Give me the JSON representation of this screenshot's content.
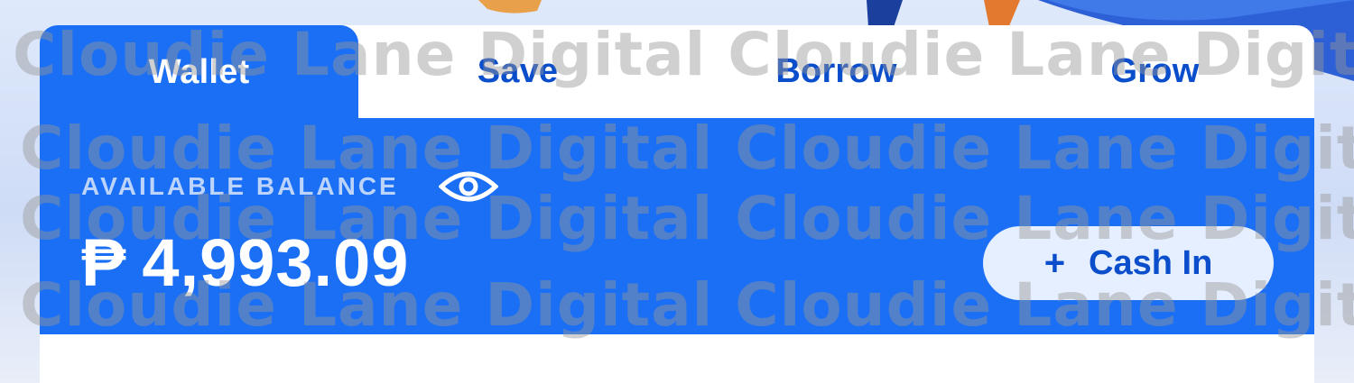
{
  "tabs": [
    {
      "label": "Wallet",
      "active": true
    },
    {
      "label": "Save",
      "active": false
    },
    {
      "label": "Borrow",
      "active": false
    },
    {
      "label": "Grow",
      "active": false
    }
  ],
  "balance": {
    "label": "AVAILABLE BALANCE",
    "currency_symbol": "₱",
    "amount": "4,993.09",
    "visibility_icon": "eye-icon"
  },
  "actions": {
    "cash_in_icon": "plus-icon",
    "cash_in_label": "Cash In"
  },
  "watermark": {
    "text": "Cloudie Lane Digital Cloudie Lane Digital"
  },
  "colors": {
    "primary": "#1a6ff5",
    "tab_text": "#0b4ecb",
    "button_bg": "#e6efff"
  }
}
